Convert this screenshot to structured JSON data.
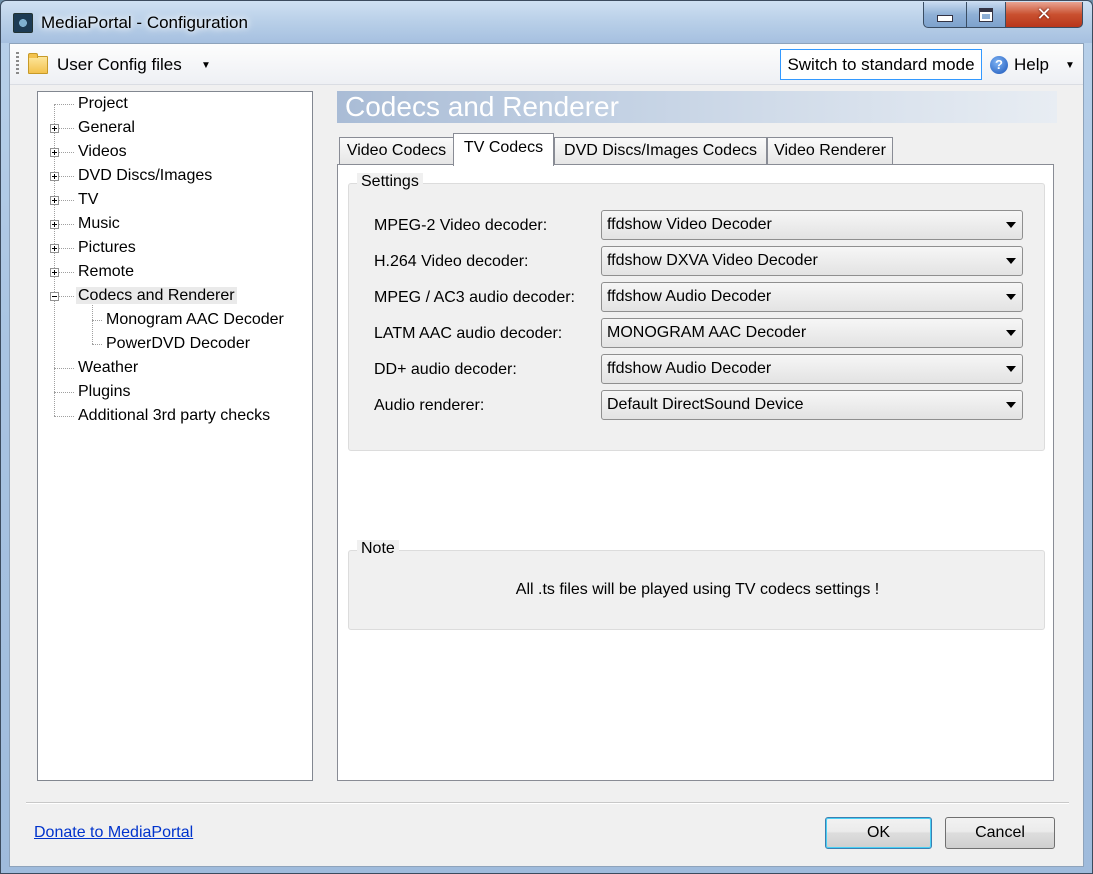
{
  "window": {
    "title": "MediaPortal - Configuration",
    "close_symbol": "✕"
  },
  "toolbar": {
    "config_menu_label": "User Config files",
    "switch_mode_label": "Switch to standard mode",
    "help_label": "Help",
    "help_icon_glyph": "?",
    "dropdown_glyph": "▼"
  },
  "tree": {
    "items": [
      {
        "label": "Project",
        "expander": "none"
      },
      {
        "label": "General",
        "expander": "plus"
      },
      {
        "label": "Videos",
        "expander": "plus"
      },
      {
        "label": "DVD Discs/Images",
        "expander": "plus"
      },
      {
        "label": "TV",
        "expander": "plus"
      },
      {
        "label": "Music",
        "expander": "plus"
      },
      {
        "label": "Pictures",
        "expander": "plus"
      },
      {
        "label": "Remote",
        "expander": "plus"
      },
      {
        "label": "Codecs and Renderer",
        "expander": "minus",
        "selected": true
      },
      {
        "label": "Monogram AAC Decoder",
        "expander": "none",
        "child": true
      },
      {
        "label": "PowerDVD Decoder",
        "expander": "none",
        "child": true
      },
      {
        "label": "Weather",
        "expander": "none"
      },
      {
        "label": "Plugins",
        "expander": "none"
      },
      {
        "label": "Additional 3rd party checks",
        "expander": "none"
      }
    ]
  },
  "panel": {
    "title": "Codecs and Renderer",
    "tabs": [
      {
        "label": "Video Codecs"
      },
      {
        "label": "TV Codecs",
        "active": true
      },
      {
        "label": "DVD Discs/Images Codecs"
      },
      {
        "label": "Video Renderer"
      }
    ],
    "settings_group_label": "Settings",
    "fields": [
      {
        "label": "MPEG-2 Video decoder:",
        "value": "ffdshow Video Decoder"
      },
      {
        "label": "H.264 Video decoder:",
        "value": "ffdshow DXVA Video Decoder"
      },
      {
        "label": "MPEG / AC3 audio decoder:",
        "value": "ffdshow Audio Decoder"
      },
      {
        "label": "LATM AAC audio decoder:",
        "value": "MONOGRAM AAC Decoder"
      },
      {
        "label": "DD+ audio decoder:",
        "value": "ffdshow Audio Decoder"
      },
      {
        "label": "Audio renderer:",
        "value": "Default DirectSound Device"
      }
    ],
    "note_group_label": "Note",
    "note_text": "All .ts files will be played using TV codecs settings !"
  },
  "footer": {
    "donate_link": "Donate to MediaPortal",
    "ok_label": "OK",
    "cancel_label": "Cancel"
  },
  "colors": {
    "link": "#0033cc",
    "close_button": "#c9502f",
    "panel_header_gradient_start": "#a9bcd6"
  }
}
